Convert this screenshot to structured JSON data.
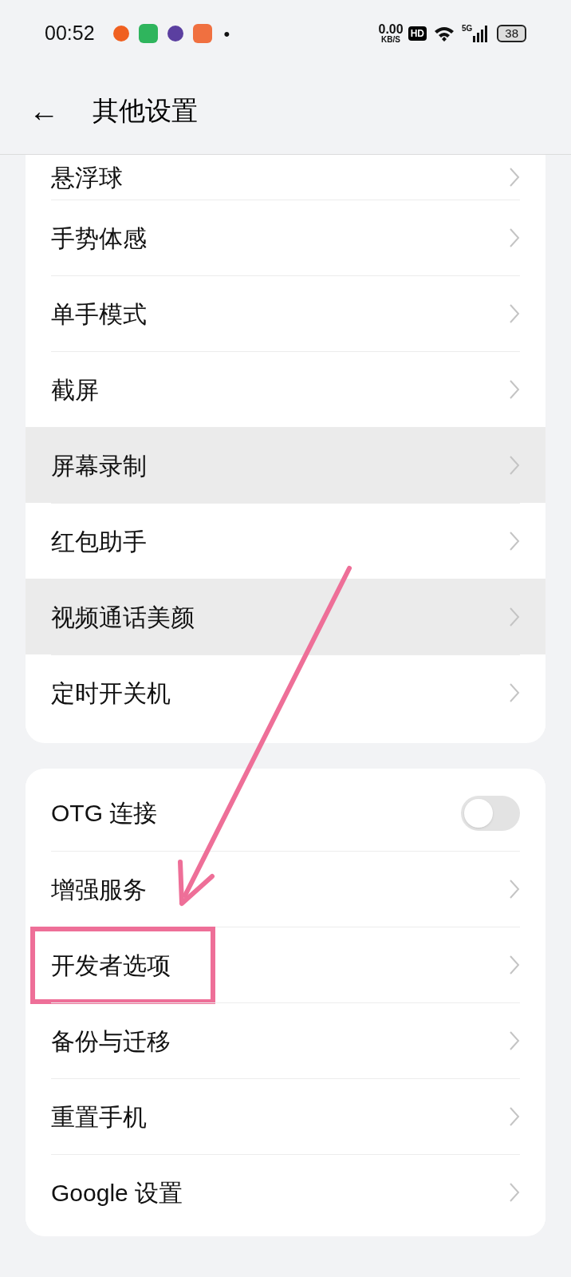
{
  "status_bar": {
    "time": "00:52",
    "notification_dot": "•",
    "net_speed": "0.00",
    "net_unit": "KB/S",
    "hd": "HD",
    "network": "5G",
    "battery": "38"
  },
  "header": {
    "back": "←",
    "title": "其他设置"
  },
  "groups": [
    {
      "items": [
        {
          "label": "悬浮球",
          "kind": "link",
          "highlighted": false
        },
        {
          "label": "手势体感",
          "kind": "link",
          "highlighted": false
        },
        {
          "label": "单手模式",
          "kind": "link",
          "highlighted": false
        },
        {
          "label": "截屏",
          "kind": "link",
          "highlighted": false
        },
        {
          "label": "屏幕录制",
          "kind": "link",
          "highlighted": true
        },
        {
          "label": "红包助手",
          "kind": "link",
          "highlighted": false
        },
        {
          "label": "视频通话美颜",
          "kind": "link",
          "highlighted": true
        },
        {
          "label": "定时开关机",
          "kind": "link",
          "highlighted": false
        }
      ]
    },
    {
      "items": [
        {
          "label": "OTG 连接",
          "kind": "switch",
          "on": false,
          "highlighted": false
        },
        {
          "label": "增强服务",
          "kind": "link",
          "highlighted": false
        },
        {
          "label": "开发者选项",
          "kind": "link",
          "highlighted": false,
          "annotated": true
        },
        {
          "label": "备份与迁移",
          "kind": "link",
          "highlighted": false
        },
        {
          "label": "重置手机",
          "kind": "link",
          "highlighted": false
        },
        {
          "label": "Google 设置",
          "kind": "link",
          "highlighted": false
        }
      ]
    }
  ]
}
